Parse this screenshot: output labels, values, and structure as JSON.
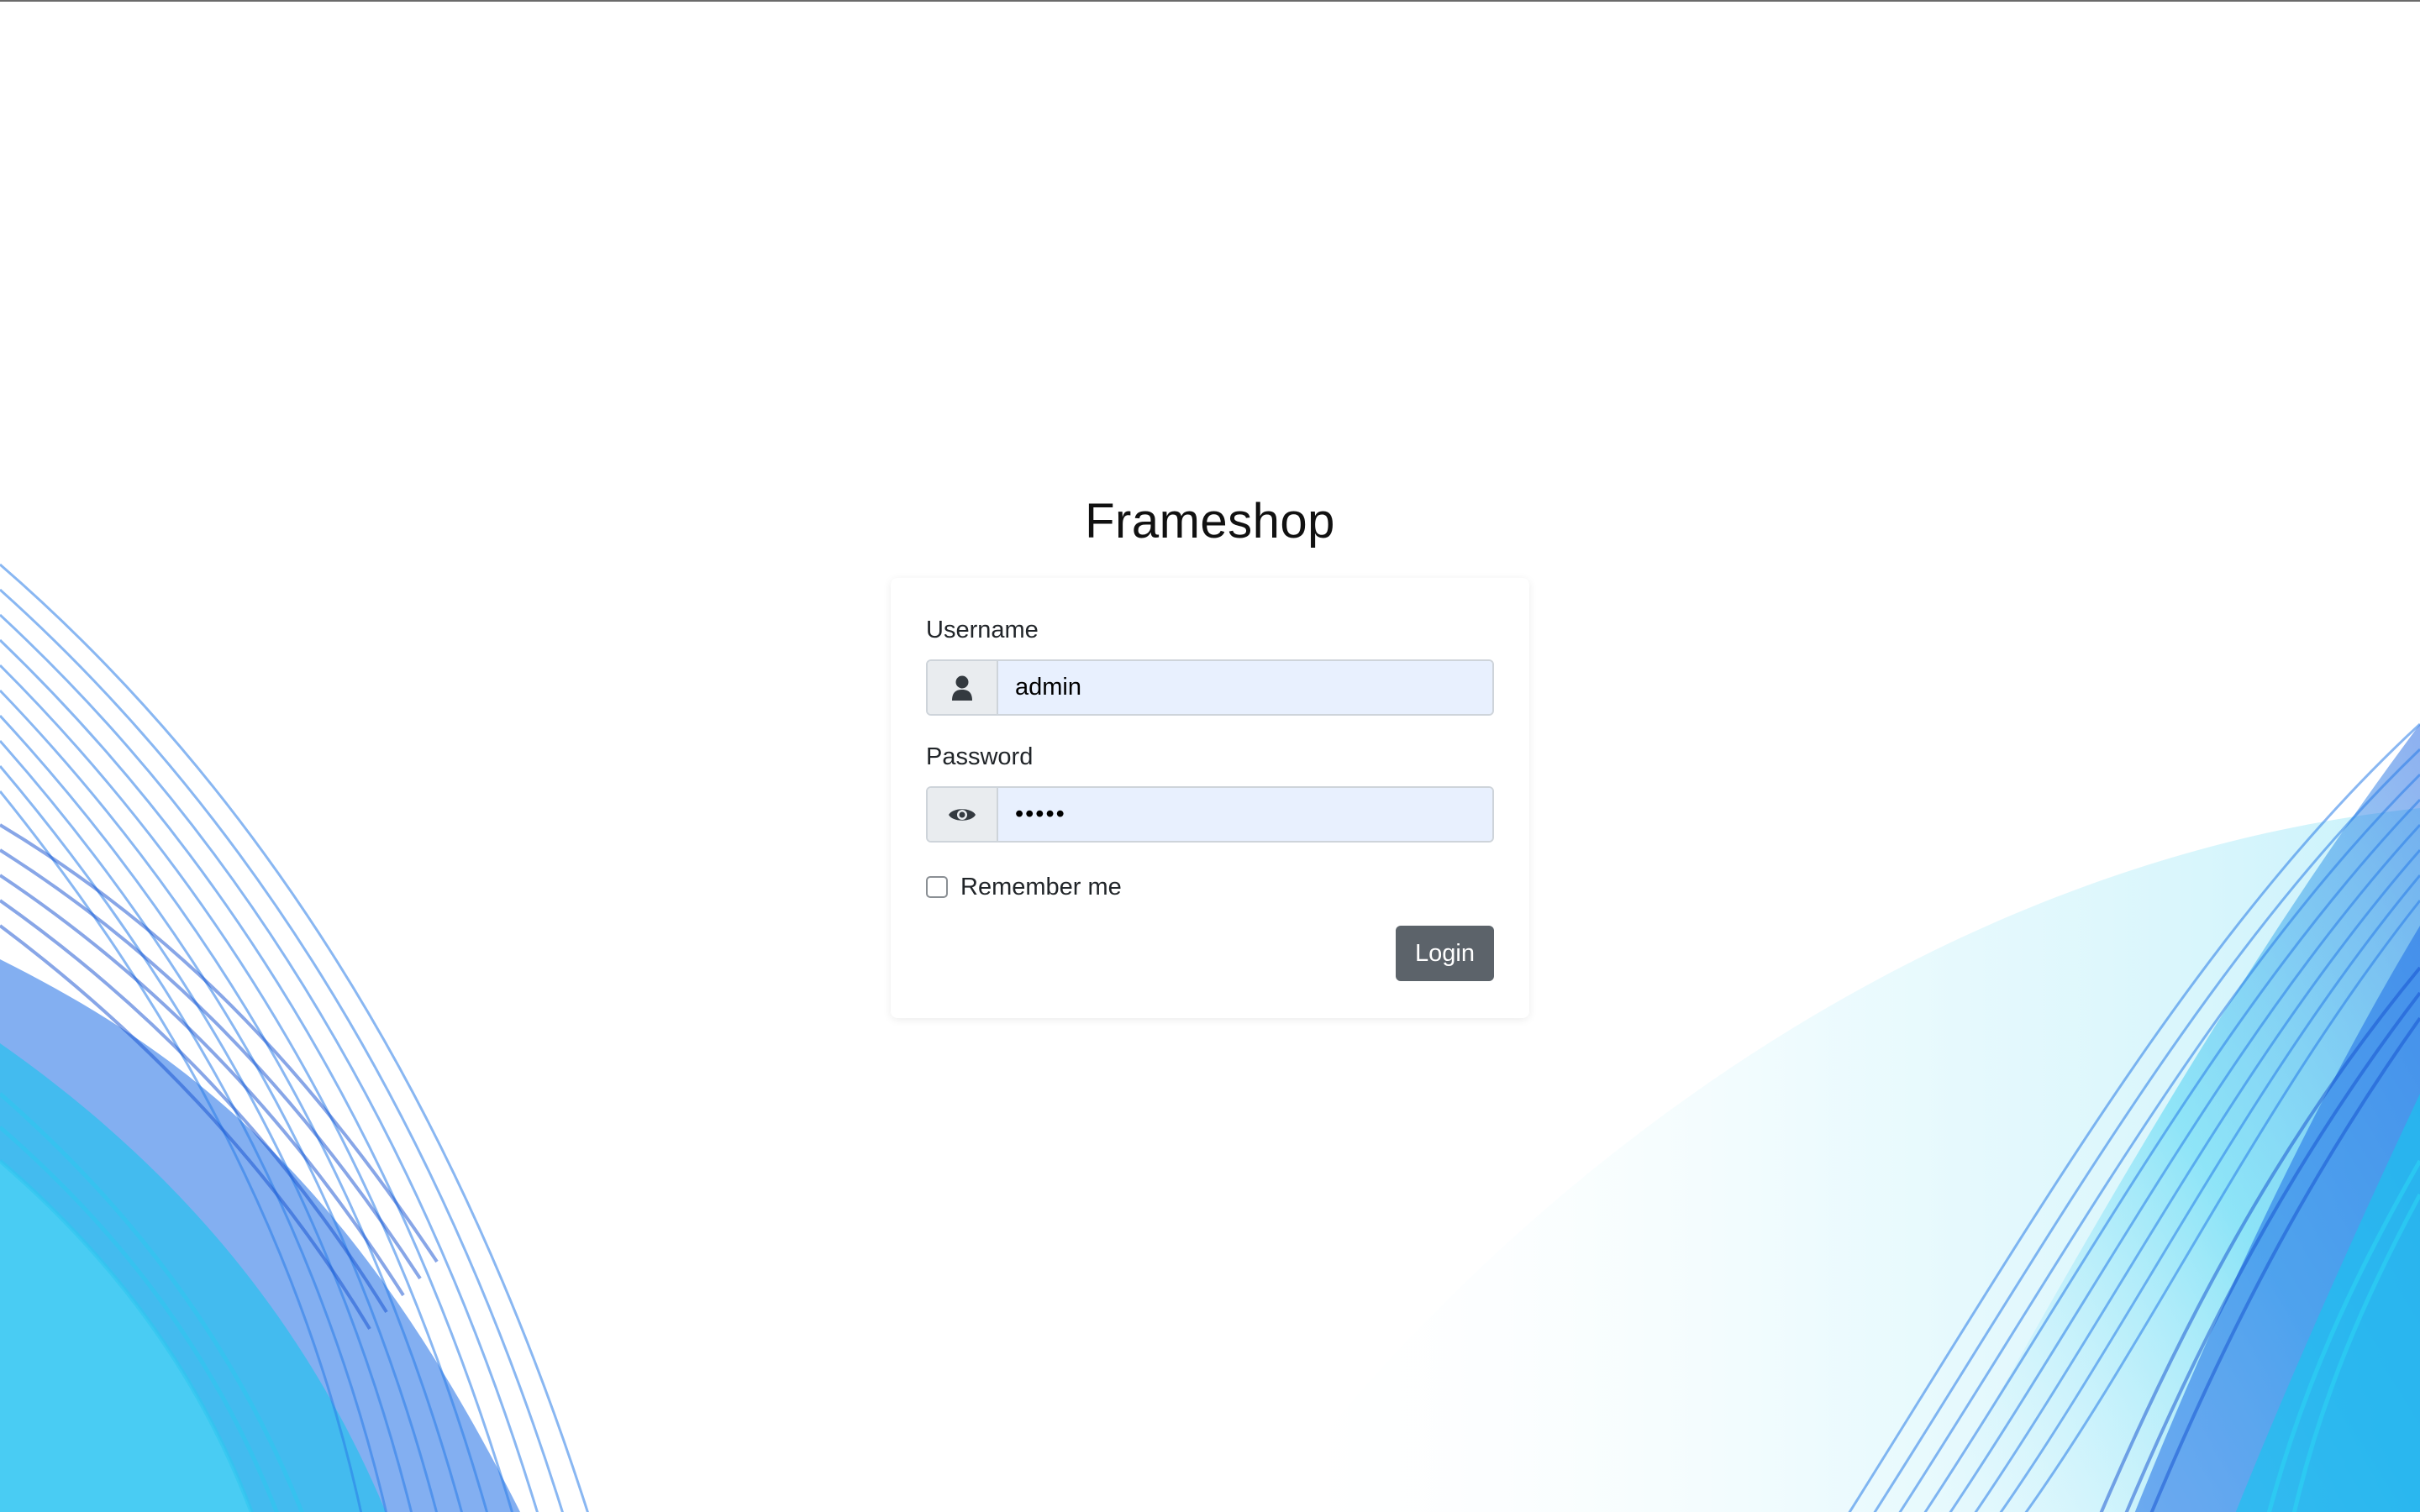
{
  "app": {
    "title": "Frameshop"
  },
  "login_form": {
    "username_label": "Username",
    "username_value": "admin",
    "password_label": "Password",
    "password_value": "•••••",
    "remember_label": "Remember me",
    "remember_checked": false,
    "login_button_label": "Login"
  },
  "icons": {
    "username_addon": "user-icon",
    "password_addon": "eye-icon"
  },
  "colors": {
    "button": "#5c636a",
    "input_autofill_bg": "#e8f0fe",
    "addon_bg": "#e9ecef",
    "wave_primary": "#1a5fe0",
    "wave_secondary": "#18c8f0"
  }
}
